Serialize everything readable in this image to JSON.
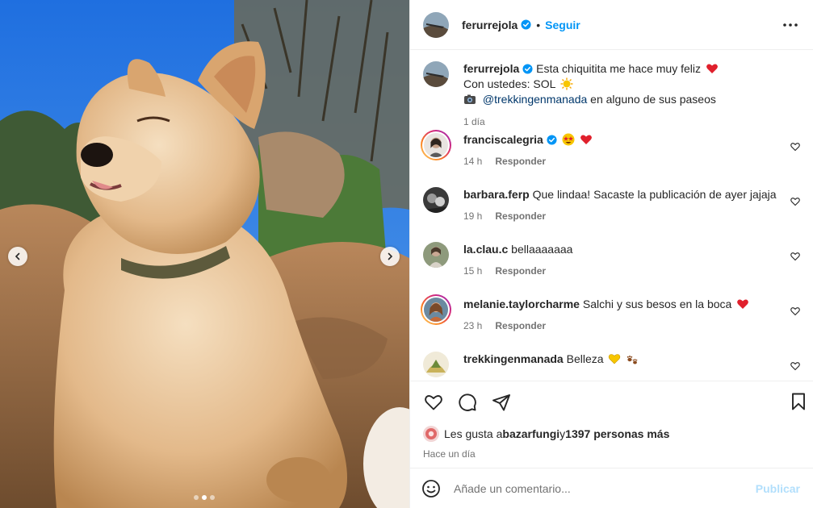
{
  "post": {
    "author": "ferurrejola",
    "follow_label": "Seguir",
    "separator": "•",
    "caption_line1": "Esta chiquitita me hace muy feliz",
    "caption_line2": "Con ustedes: SOL",
    "caption_mention": "@trekkingenmanada",
    "caption_line3_tail": " en alguno de sus paseos",
    "caption_time": "1 día",
    "carousel": {
      "count": 3,
      "active": 1
    }
  },
  "comments": [
    {
      "user": "franciscalegria",
      "text": "",
      "time": "14 h",
      "reply": "Responder",
      "verified": true,
      "emojis": [
        "star-struck-emoji",
        "red-heart-emoji"
      ]
    },
    {
      "user": "barbara.ferp",
      "text": "Que lindaa! Sacaste la publicación de ayer jajaja",
      "time": "19 h",
      "reply": "Responder"
    },
    {
      "user": "la.clau.c",
      "text": "bellaaaaaaa",
      "time": "15 h",
      "reply": "Responder"
    },
    {
      "user": "melanie.taylorcharme",
      "text": "Salchi y sus besos en la boca",
      "time": "23 h",
      "reply": "Responder",
      "emojis": [
        "red-heart-emoji"
      ]
    },
    {
      "user": "trekkingenmanada",
      "text": "Belleza",
      "emojis": [
        "yellow-heart-emoji",
        "paw-prints-emoji"
      ]
    }
  ],
  "likes": {
    "prefix": "Les gusta a ",
    "user": "bazarfungi",
    "connector": " y ",
    "others": "1397 personas más"
  },
  "timestamp": "Hace un día",
  "add_comment": {
    "placeholder": "Añade un comentario...",
    "publish_label": "Publicar"
  },
  "colors": {
    "accent": "#0095f6",
    "verified": "#0095f6",
    "heart": "#ff3040",
    "muted": "#737373"
  }
}
